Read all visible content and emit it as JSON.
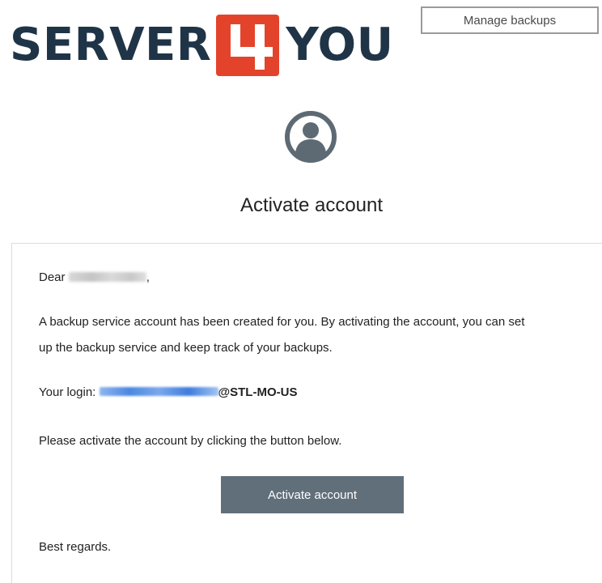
{
  "header": {
    "logo_text_left": "SERVER",
    "logo_badge_text": "4",
    "logo_text_right": "YOU",
    "manage_backups_label": "Manage backups"
  },
  "hero": {
    "avatar_icon": "user-icon",
    "title": "Activate account"
  },
  "email": {
    "greeting_prefix": "Dear",
    "greeting_suffix": ",",
    "body_line_1": "A backup service account has been created for you. By activating the account, you can set",
    "body_line_2": "up the backup service and keep track of your backups.",
    "login_label": "Your login:",
    "login_suffix": "@STL-MO-US",
    "instruction": "Please activate the account by clicking the button below.",
    "activate_button_label": "Activate account",
    "signoff": "Best regards."
  },
  "colors": {
    "brand_dark": "#1f3447",
    "brand_red": "#e4432b",
    "button_gray": "#616f7b",
    "link_blue": "#3f7cdc"
  }
}
